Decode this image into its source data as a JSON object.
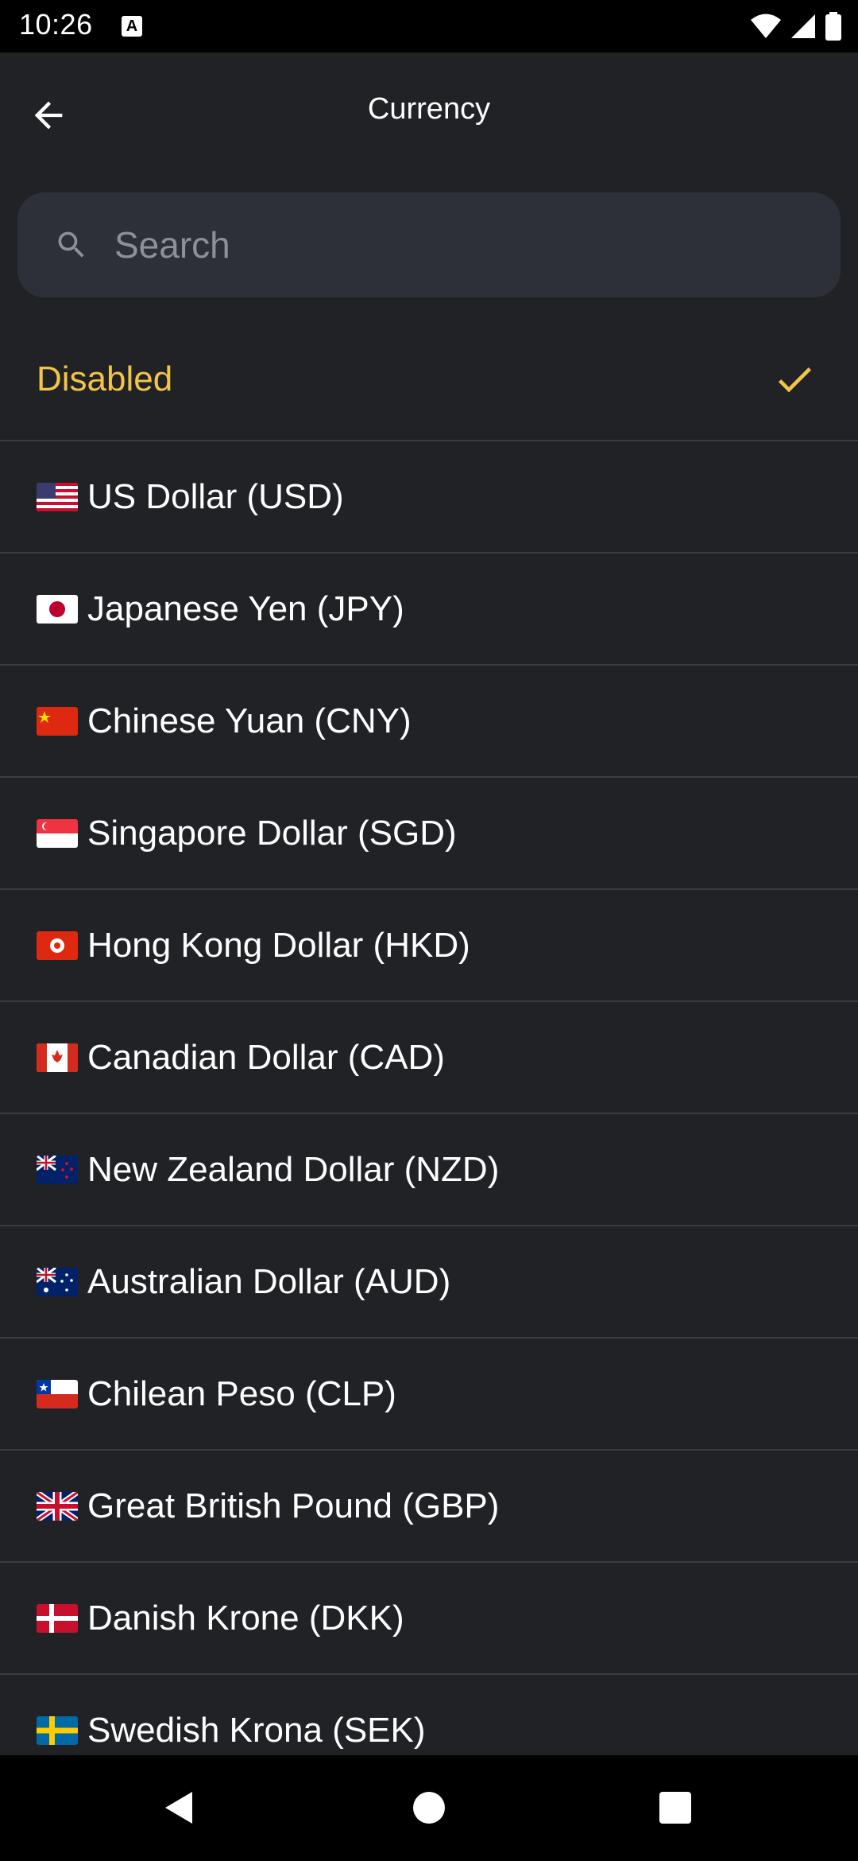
{
  "status_bar": {
    "time": "10:26",
    "indicator": "A",
    "icons": [
      "wifi-icon",
      "signal-icon",
      "battery-icon"
    ]
  },
  "app_bar": {
    "title": "Currency",
    "back_icon": "arrow-left-icon"
  },
  "search": {
    "placeholder": "Search",
    "value": "",
    "icon": "search-icon"
  },
  "colors": {
    "background": "#202226",
    "search_bg": "#2d3038",
    "selected_accent": "#f3c447",
    "divider": "#393c43"
  },
  "list": {
    "disabled": {
      "label": "Disabled",
      "selected": true
    },
    "items": [
      {
        "label": "US Dollar (USD)",
        "flag": "us-flag-icon"
      },
      {
        "label": "Japanese Yen (JPY)",
        "flag": "jp-flag-icon"
      },
      {
        "label": "Chinese Yuan (CNY)",
        "flag": "cn-flag-icon"
      },
      {
        "label": "Singapore Dollar (SGD)",
        "flag": "sg-flag-icon"
      },
      {
        "label": "Hong Kong Dollar (HKD)",
        "flag": "hk-flag-icon"
      },
      {
        "label": "Canadian Dollar (CAD)",
        "flag": "ca-flag-icon"
      },
      {
        "label": "New Zealand Dollar (NZD)",
        "flag": "nz-flag-icon"
      },
      {
        "label": "Australian Dollar (AUD)",
        "flag": "au-flag-icon"
      },
      {
        "label": "Chilean Peso (CLP)",
        "flag": "cl-flag-icon"
      },
      {
        "label": "Great British Pound (GBP)",
        "flag": "gb-flag-icon"
      },
      {
        "label": "Danish Krone (DKK)",
        "flag": "dk-flag-icon"
      },
      {
        "label": "Swedish Krona (SEK)",
        "flag": "se-flag-icon"
      }
    ]
  },
  "nav_bar": {
    "buttons": [
      "back-triangle-icon",
      "home-circle-icon",
      "recents-square-icon"
    ]
  }
}
